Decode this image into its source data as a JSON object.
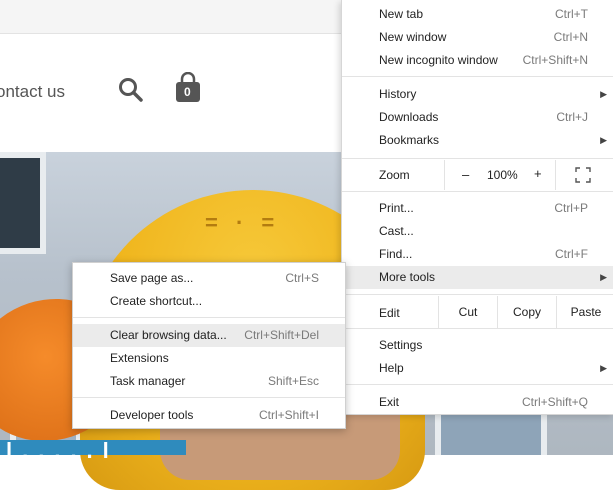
{
  "site": {
    "nav_contact": "ontact us",
    "cart_count": "0",
    "hero_fragment": "l.....l"
  },
  "menu": {
    "new_tab": {
      "label": "New tab",
      "shortcut": "Ctrl+T"
    },
    "new_window": {
      "label": "New window",
      "shortcut": "Ctrl+N"
    },
    "new_incognito": {
      "label": "New incognito window",
      "shortcut": "Ctrl+Shift+N"
    },
    "history": {
      "label": "History"
    },
    "downloads": {
      "label": "Downloads",
      "shortcut": "Ctrl+J"
    },
    "bookmarks": {
      "label": "Bookmarks"
    },
    "zoom": {
      "label": "Zoom",
      "minus": "–",
      "value": "100%",
      "plus": "+"
    },
    "print": {
      "label": "Print...",
      "shortcut": "Ctrl+P"
    },
    "cast": {
      "label": "Cast..."
    },
    "find": {
      "label": "Find...",
      "shortcut": "Ctrl+F"
    },
    "more_tools": {
      "label": "More tools"
    },
    "edit": {
      "label": "Edit",
      "cut": "Cut",
      "copy": "Copy",
      "paste": "Paste"
    },
    "settings": {
      "label": "Settings"
    },
    "help": {
      "label": "Help"
    },
    "exit": {
      "label": "Exit",
      "shortcut": "Ctrl+Shift+Q"
    }
  },
  "submenu": {
    "save_page": {
      "label": "Save page as...",
      "shortcut": "Ctrl+S"
    },
    "create_shortcut": {
      "label": "Create shortcut..."
    },
    "clear_browsing": {
      "label": "Clear browsing data...",
      "shortcut": "Ctrl+Shift+Del"
    },
    "extensions": {
      "label": "Extensions"
    },
    "task_manager": {
      "label": "Task manager",
      "shortcut": "Shift+Esc"
    },
    "developer_tools": {
      "label": "Developer tools",
      "shortcut": "Ctrl+Shift+I"
    }
  }
}
